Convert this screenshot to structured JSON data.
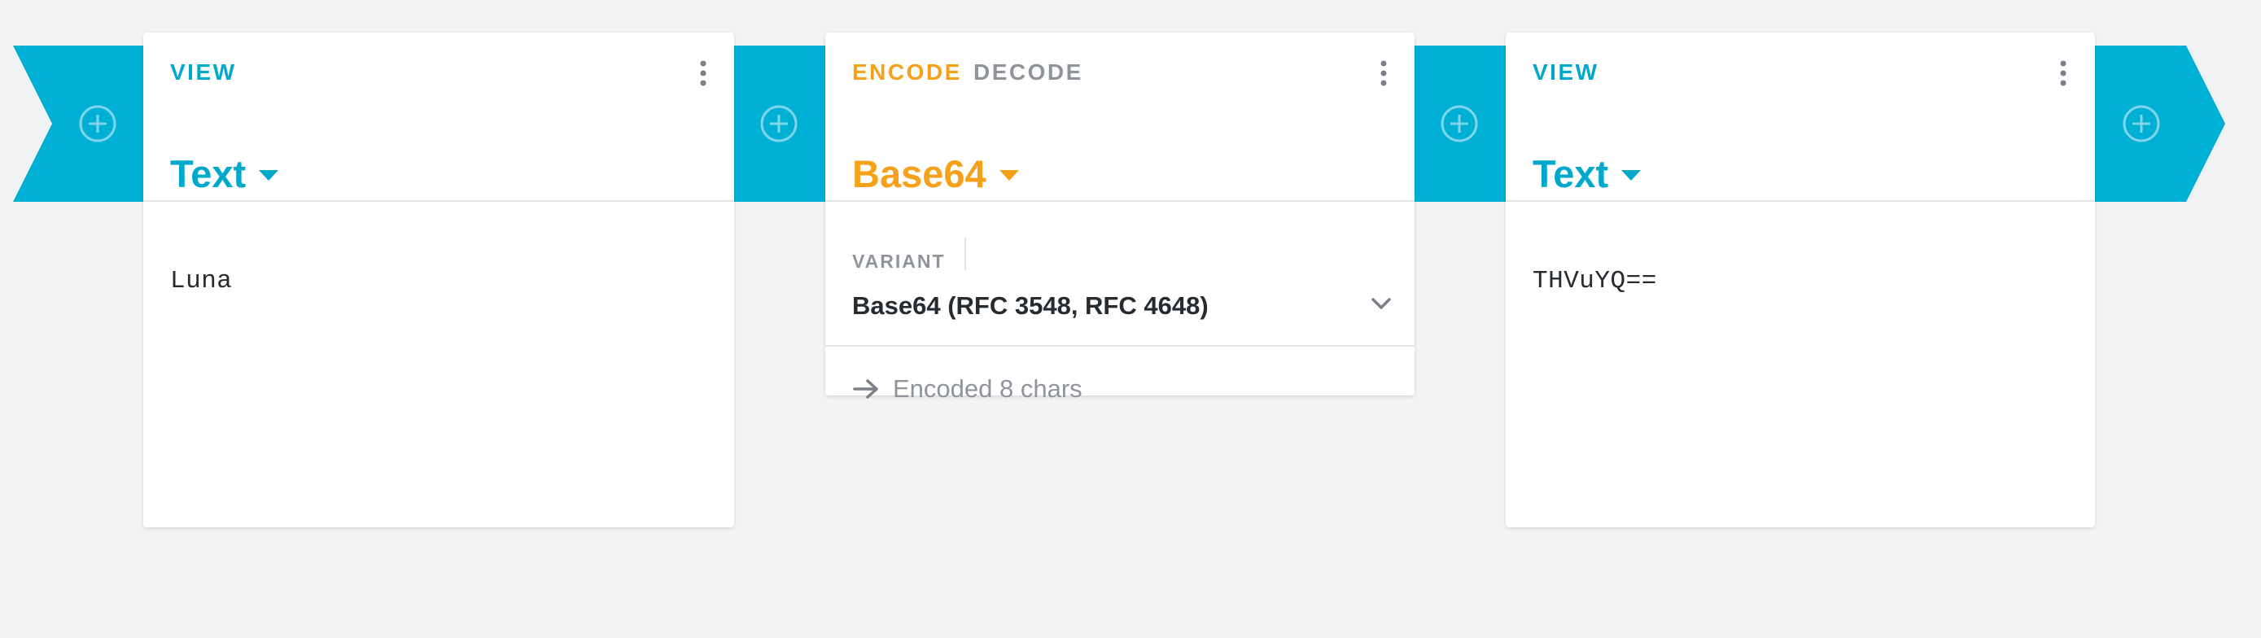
{
  "colors": {
    "ribbon": "#00b0d4",
    "view_accent": "#00a9cc",
    "encode_accent": "#f7a01a",
    "muted": "#8f949c",
    "background": "#f2f3f5"
  },
  "add_buttons": [
    {
      "icon": "plus-circle-icon"
    },
    {
      "icon": "plus-circle-icon"
    },
    {
      "icon": "plus-circle-icon"
    },
    {
      "icon": "plus-circle-icon"
    }
  ],
  "cards": {
    "input_view": {
      "tab": "VIEW",
      "menu_icon": "more-vertical-icon",
      "format": "Text",
      "content": "Luna"
    },
    "encoder": {
      "tabs": {
        "encode": "ENCODE",
        "decode": "DECODE"
      },
      "active_tab": "ENCODE",
      "menu_icon": "more-vertical-icon",
      "format": "Base64",
      "variant": {
        "label": "VARIANT",
        "value": "Base64 (RFC 3548, RFC 4648)"
      },
      "status": {
        "icon": "arrow-right-icon",
        "text": "Encoded 8 chars"
      }
    },
    "output_view": {
      "tab": "VIEW",
      "menu_icon": "more-vertical-icon",
      "format": "Text",
      "content": "THVuYQ=="
    }
  }
}
